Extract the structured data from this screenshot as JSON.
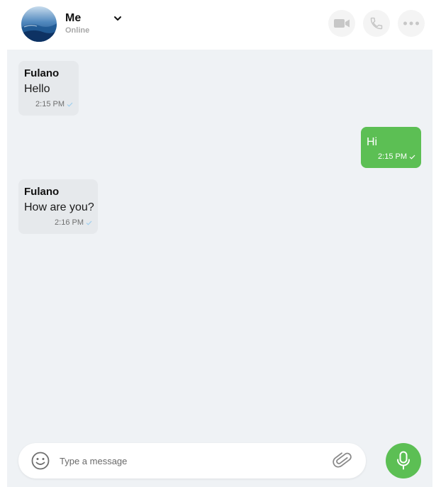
{
  "header": {
    "user_name": "Me",
    "user_status": "Online",
    "icons": {
      "avatar": "avatar-image",
      "dropdown": "chevron-down-icon",
      "video": "video-camera-icon",
      "call": "phone-icon",
      "more": "more-dots-icon"
    }
  },
  "messages": [
    {
      "direction": "incoming",
      "sender": "Fulano",
      "text": "Hello",
      "time": "2:15 PM",
      "status_icon": "check-icon"
    },
    {
      "direction": "outgoing",
      "sender": "",
      "text": "Hi",
      "time": "2:15 PM",
      "status_icon": "check-icon"
    },
    {
      "direction": "incoming",
      "sender": "Fulano",
      "text": "How are you?",
      "time": "2:16 PM",
      "status_icon": "check-icon"
    }
  ],
  "composer": {
    "placeholder": "Type a message",
    "value": "",
    "icons": {
      "emoji": "emoji-icon",
      "attach": "paperclip-icon",
      "mic": "microphone-icon"
    }
  },
  "colors": {
    "accent": "#5cbf54",
    "chat_background": "#eff2f5",
    "incoming_bubble": "#e6e9ec",
    "button_background": "#f4f4f4",
    "icon_gray": "#c7c7c7",
    "tick_blue": "#9fcfee"
  }
}
